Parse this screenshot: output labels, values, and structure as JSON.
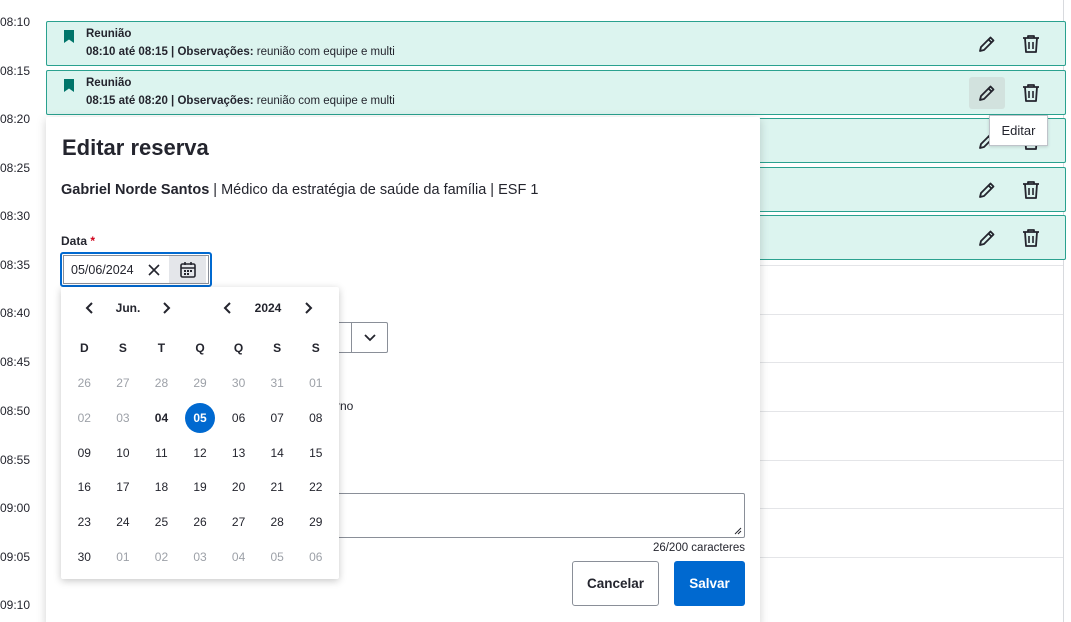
{
  "timeline": {
    "times": [
      "08:10",
      "08:15",
      "08:20",
      "08:25",
      "08:30",
      "08:35",
      "08:40",
      "08:45",
      "08:50",
      "08:55",
      "09:00",
      "09:05",
      "09:10"
    ]
  },
  "bookings": [
    {
      "title": "Reunião",
      "time_range": "08:10 até 08:15",
      "obs_label": "Observações:",
      "obs_text": "reunião com equipe e multi"
    },
    {
      "title": "Reunião",
      "time_range": "08:15 até 08:20",
      "obs_label": "Observações:",
      "obs_text": "reunião com equipe e multi"
    }
  ],
  "tooltip": {
    "text": "Editar"
  },
  "modal": {
    "title": "Editar reserva",
    "professional_name": "Gabriel Norde Santos",
    "professional_role": " | Médico da estratégia de saúde da família | ESF 1",
    "date_label": "Data",
    "date_required_mark": "*",
    "date_value": "05/06/2024",
    "partial_text": "rno",
    "counter": "26/200 caracteres",
    "cancel_label": "Cancelar",
    "save_label": "Salvar"
  },
  "datepicker": {
    "month": "Jun.",
    "year": "2024",
    "weekdays": [
      "D",
      "S",
      "T",
      "Q",
      "Q",
      "S",
      "S"
    ],
    "weeks": [
      [
        {
          "d": "26",
          "muted": true
        },
        {
          "d": "27",
          "muted": true
        },
        {
          "d": "28",
          "muted": true
        },
        {
          "d": "29",
          "muted": true
        },
        {
          "d": "30",
          "muted": true
        },
        {
          "d": "31",
          "muted": true
        },
        {
          "d": "01",
          "muted": true
        }
      ],
      [
        {
          "d": "02",
          "muted": true
        },
        {
          "d": "03",
          "muted": true
        },
        {
          "d": "04",
          "today": true
        },
        {
          "d": "05",
          "selected": true
        },
        {
          "d": "06"
        },
        {
          "d": "07"
        },
        {
          "d": "08"
        }
      ],
      [
        {
          "d": "09"
        },
        {
          "d": "10"
        },
        {
          "d": "11"
        },
        {
          "d": "12"
        },
        {
          "d": "13"
        },
        {
          "d": "14"
        },
        {
          "d": "15"
        }
      ],
      [
        {
          "d": "16"
        },
        {
          "d": "17"
        },
        {
          "d": "18"
        },
        {
          "d": "19"
        },
        {
          "d": "20"
        },
        {
          "d": "21"
        },
        {
          "d": "22"
        }
      ],
      [
        {
          "d": "23"
        },
        {
          "d": "24"
        },
        {
          "d": "25"
        },
        {
          "d": "26"
        },
        {
          "d": "27"
        },
        {
          "d": "28"
        },
        {
          "d": "29"
        }
      ],
      [
        {
          "d": "30"
        },
        {
          "d": "01",
          "muted": true
        },
        {
          "d": "02",
          "muted": true
        },
        {
          "d": "03",
          "muted": true
        },
        {
          "d": "04",
          "muted": true
        },
        {
          "d": "05",
          "muted": true
        },
        {
          "d": "06",
          "muted": true
        }
      ]
    ]
  },
  "colors": {
    "accent": "#0069d0",
    "slot_bg": "#dcf4ef",
    "slot_border": "#2aa18f",
    "bookmark": "#00756a"
  },
  "icons": {
    "bookmark": "bookmark-icon",
    "edit": "pencil-icon",
    "delete": "trash-icon",
    "calendar": "calendar-icon",
    "clear": "close-icon",
    "select": "chevron-down-icon"
  }
}
